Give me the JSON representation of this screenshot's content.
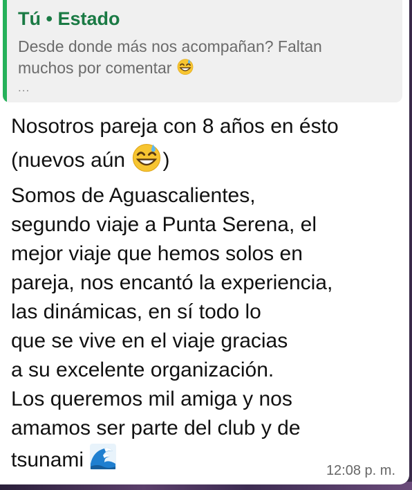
{
  "quote": {
    "title": "Tú • Estado",
    "text_line1": "Desde donde más nos acompañan? Faltan",
    "text_line2": "muchos por comentar",
    "ellipsis": "...",
    "accent_color": "#25b15a"
  },
  "message": {
    "line1": "Nosotros pareja con 8 años en ésto",
    "line2_before": "(nuevos aún",
    "line2_after": ")",
    "lines": [
      "Somos de Aguascalientes,",
      "segundo viaje a Punta Serena, el",
      "mejor viaje que hemos solos en",
      "pareja, nos encantó la experiencia,",
      "las dinámicas, en sí todo lo",
      "que se vive en el viaje gracias",
      "a su excelente organización.",
      "Los queremos mil amiga y nos",
      "amamos ser parte del club y de"
    ],
    "last_line": "tsunami",
    "time": "12:08 p. m."
  },
  "icons": {
    "quote_emoji": "grinning-sweat-emoji-icon",
    "inline_emoji": "grinning-sweat-emoji-icon",
    "wave_emoji": "water-wave-emoji-icon"
  }
}
